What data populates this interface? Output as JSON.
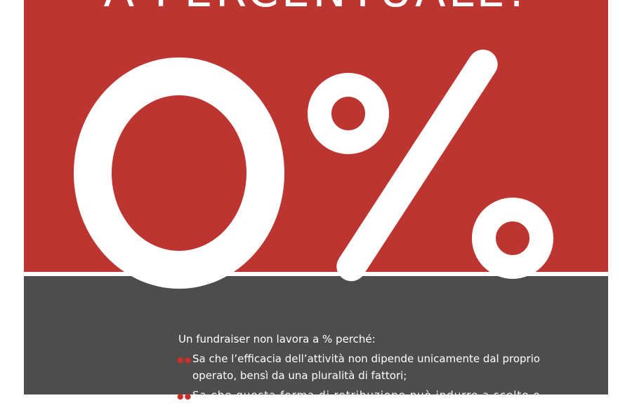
{
  "headline": "A PERCENTUALE!",
  "big_figure": "0%",
  "body": {
    "intro": "Un fundraiser non lavora a % perché:",
    "bullets": [
      "Sa che l’efficacia dell’attività non dipende unicamente dal proprio operato, bensì da una pluralità di fattori;",
      "Sa che questa forma di retribuzione può indurre a scelte e"
    ],
    "bullet_marker": "●●"
  },
  "colors": {
    "red": "#bd3530",
    "grey": "#4c4d4c",
    "white": "#ffffff",
    "bullet_red": "#c8302a"
  }
}
